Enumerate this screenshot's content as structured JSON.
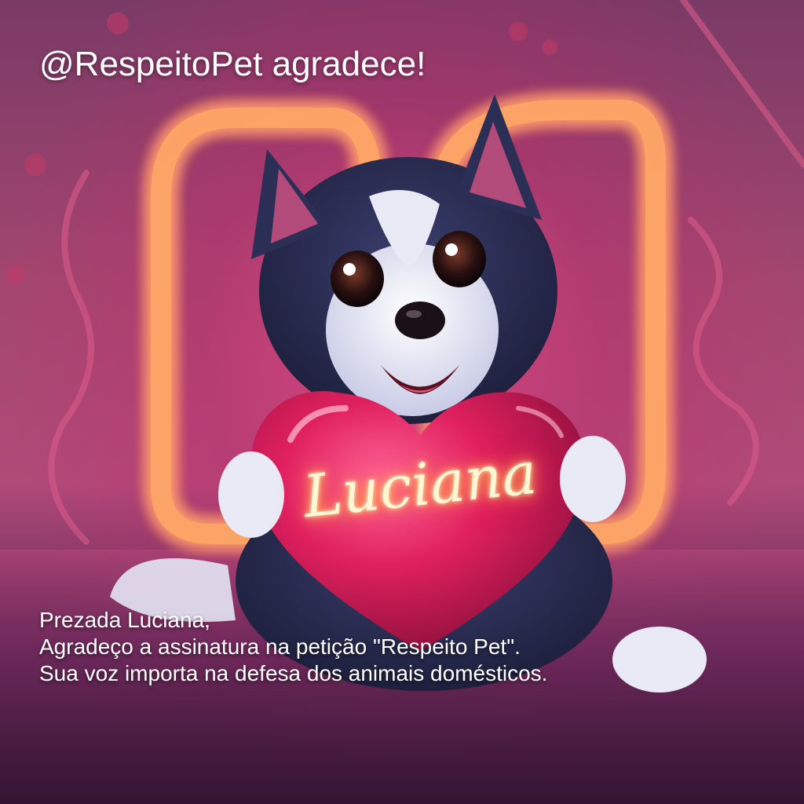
{
  "header": {
    "title": "@RespeitoPet agradece!"
  },
  "artwork": {
    "subject": "cartoon-puppy-holding-heart",
    "heart_text": "Luciana",
    "colors": {
      "neon_yellow": "#ffe94a",
      "neon_pink": "#ff3c7a",
      "heart": "#e0205f",
      "fur_dark": "#2c2f55",
      "fur_light": "#e9eaf6"
    }
  },
  "message": {
    "greeting": "Prezada Luciana,",
    "line1": "Agradeço a assinatura na petição \"Respeito Pet\".",
    "line2": "Sua voz importa na defesa dos animais domésticos."
  }
}
